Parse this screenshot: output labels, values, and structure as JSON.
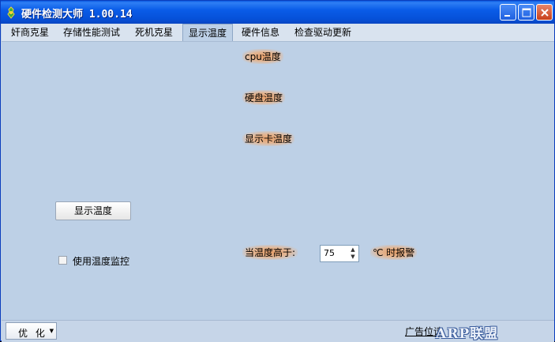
{
  "window": {
    "title": "硬件检测大师 1.00.14"
  },
  "titlebar": {
    "icon": "app-icon",
    "controls": [
      "minimize-icon",
      "maximize-icon",
      "close-icon"
    ]
  },
  "tabs": [
    {
      "label": "奸商克星",
      "active": false
    },
    {
      "label": "存储性能测试",
      "active": false
    },
    {
      "label": "死机克星",
      "active": false
    },
    {
      "label": "显示温度",
      "active": true
    },
    {
      "label": "硬件信息",
      "active": false
    },
    {
      "label": "检查驱动更新",
      "active": false
    }
  ],
  "temps": {
    "cpu_label": "cpu温度",
    "disk_label": "硬盘温度",
    "gpu_label": "显示卡温度"
  },
  "show_temp_button": "显示温度",
  "monitor_checkbox": {
    "label": "使用温度监控",
    "checked": false
  },
  "alarm": {
    "prefix_label": "当温度高于:",
    "threshold_value": "75",
    "suffix_label": "℃ 时报警"
  },
  "statusbar": {
    "optimize_label": "优 化",
    "ad_text": "广告位请"
  },
  "watermark": {
    "text": "ARP联盟"
  },
  "colors": {
    "titlebar": "#0a5ce8",
    "body": "#bdd0e6",
    "glow": "#e89a60"
  }
}
